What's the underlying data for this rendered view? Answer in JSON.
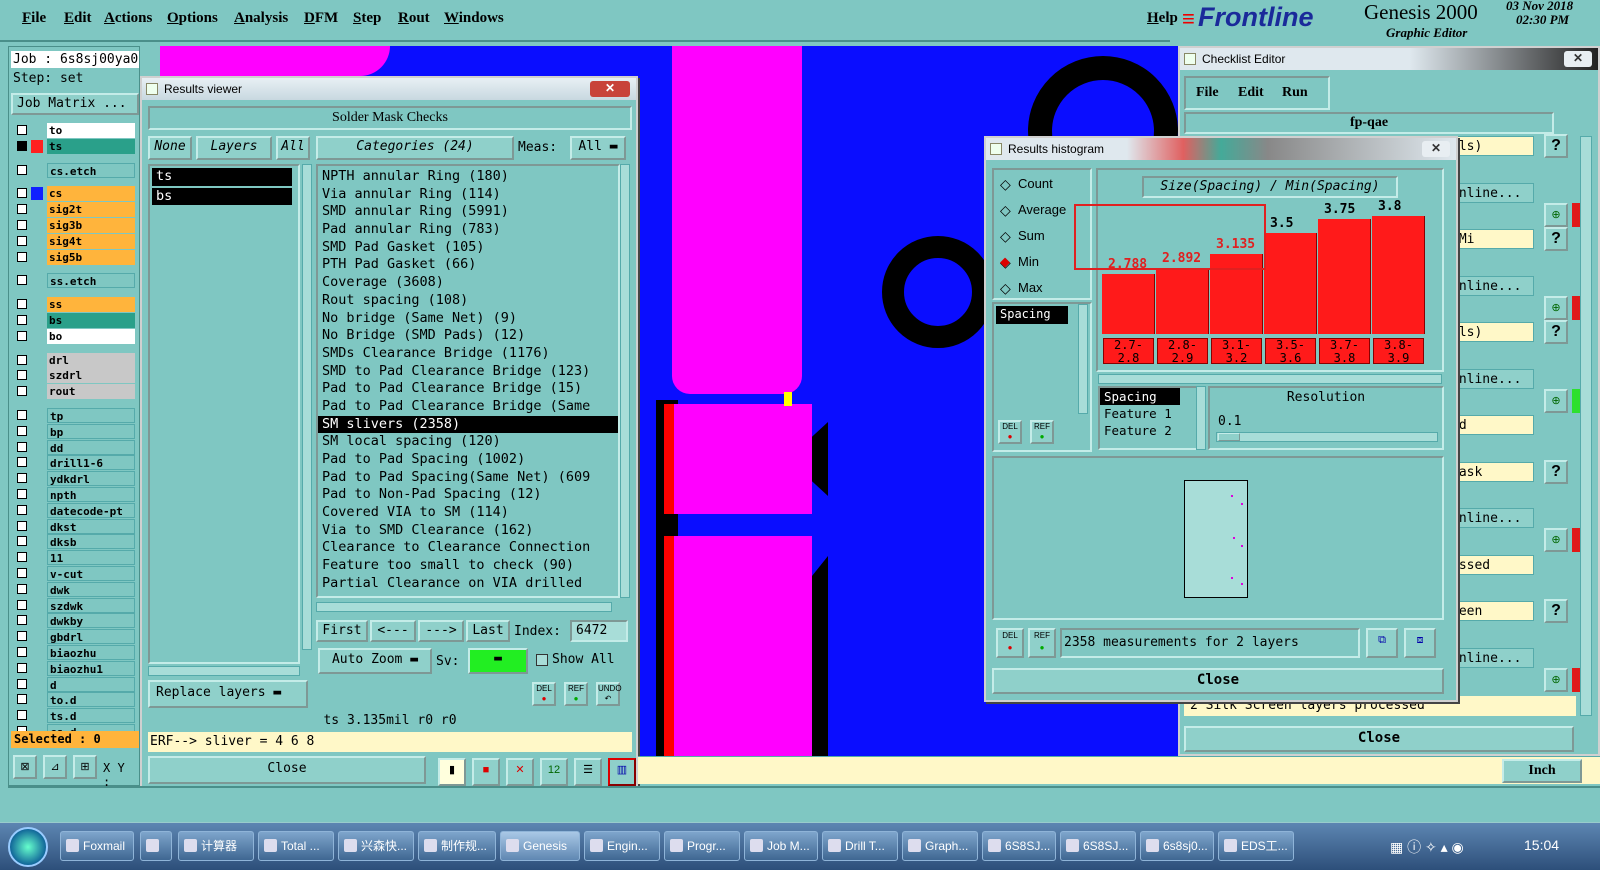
{
  "menubar": {
    "items": [
      "File",
      "Edit",
      "Actions",
      "Options",
      "Analysis",
      "DFM",
      "Step",
      "Rout",
      "Windows"
    ],
    "help": "Help"
  },
  "brand": {
    "logo": "Frontline",
    "product": "Genesis 2000",
    "subtitle": "Graphic Editor",
    "date": "03 Nov 2018",
    "time": "02:30 PM"
  },
  "job": {
    "job": "Job : 6s8sj00ya0",
    "step": "Step: set",
    "job_matrix": "Job Matrix ..."
  },
  "layers": [
    {
      "name": "to",
      "color": "#ffffff"
    },
    {
      "name": "ts",
      "color": "#2aa08a"
    },
    {
      "name": "cs.etch",
      "color": "#7fc7c2"
    },
    {
      "name": "cs",
      "color": "#ffb43c"
    },
    {
      "name": "sig2t",
      "color": "#ffb43c"
    },
    {
      "name": "sig3b",
      "color": "#ffb43c"
    },
    {
      "name": "sig4t",
      "color": "#ffb43c"
    },
    {
      "name": "sig5b",
      "color": "#ffb43c"
    },
    {
      "name": "ss.etch",
      "color": "#7fc7c2"
    },
    {
      "name": "ss",
      "color": "#ffb43c"
    },
    {
      "name": "bs",
      "color": "#2aa08a"
    },
    {
      "name": "bo",
      "color": "#ffffff"
    },
    {
      "name": "drl",
      "color": "#c8c8c8"
    },
    {
      "name": "szdrl",
      "color": "#c8c8c8"
    },
    {
      "name": "rout",
      "color": "#c8c8c8"
    },
    {
      "name": "tp",
      "color": "#7fc7c2"
    },
    {
      "name": "bp",
      "color": "#7fc7c2"
    },
    {
      "name": "dd",
      "color": "#7fc7c2"
    },
    {
      "name": "drill1-6",
      "color": "#7fc7c2"
    },
    {
      "name": "ydkdrl",
      "color": "#7fc7c2"
    },
    {
      "name": "npth",
      "color": "#7fc7c2"
    },
    {
      "name": "datecode-pt",
      "color": "#7fc7c2"
    },
    {
      "name": "dkst",
      "color": "#7fc7c2"
    },
    {
      "name": "dksb",
      "color": "#7fc7c2"
    },
    {
      "name": "11",
      "color": "#7fc7c2"
    },
    {
      "name": "v-cut",
      "color": "#7fc7c2"
    },
    {
      "name": "dwk",
      "color": "#7fc7c2"
    },
    {
      "name": "szdwk",
      "color": "#7fc7c2"
    },
    {
      "name": "dwkby",
      "color": "#7fc7c2"
    },
    {
      "name": "gbdrl",
      "color": "#7fc7c2"
    },
    {
      "name": "biaozhu",
      "color": "#7fc7c2"
    },
    {
      "name": "biaozhu1",
      "color": "#7fc7c2"
    },
    {
      "name": "d",
      "color": "#7fc7c2"
    },
    {
      "name": "to.d",
      "color": "#7fc7c2"
    },
    {
      "name": "ts.d",
      "color": "#7fc7c2"
    },
    {
      "name": "cs.d",
      "color": "#7fc7c2"
    }
  ],
  "selected": "Selected : 0",
  "xy": "X Y :",
  "results_viewer": {
    "title": "Results viewer",
    "header": "Solder Mask Checks",
    "none": "None",
    "layers": "Layers",
    "all": "All",
    "categories": "Categories (24)",
    "meas": "Meas:",
    "meas_val": "All",
    "layer_list": [
      "ts",
      "bs"
    ],
    "categories_list": [
      "NPTH annular Ring (180)",
      "Via annular Ring (114)",
      "SMD annular Ring (5991)",
      "Pad annular Ring (783)",
      "SMD Pad Gasket (105)",
      "PTH Pad Gasket (66)",
      "Coverage (3608)",
      "Rout spacing (108)",
      "No bridge (Same Net) (9)",
      "No Bridge (SMD Pads) (12)",
      "SMDs Clearance Bridge (1176)",
      "SMD to Pad Clearance Bridge (123)",
      "Pad to Pad Clearance Bridge (15)",
      "Pad to Pad Clearance Bridge (Same",
      "SM slivers (2358)",
      "SM local spacing (120)",
      "Pad to Pad Spacing (1002)",
      "Pad to Pad Spacing(Same Net) (609",
      "Pad to Non-Pad Spacing (12)",
      "Covered VIA to SM (114)",
      "Via to SMD Clearance (162)",
      "Clearance to Clearance Connection",
      "Feature too small to check (90)",
      "Partial Clearance on VIA drilled"
    ],
    "first": "First",
    "prev": "<---",
    "next": "--->",
    "last": "Last",
    "index_label": "Index:",
    "index_val": "6472",
    "auto_zoom": "Auto Zoom",
    "sv": "Sv:",
    "show_all": "Show All",
    "replace_layers": "Replace layers",
    "del": "DEL",
    "ref": "REF",
    "undo": "UNDO",
    "status": "ts 3.135mil  r0  r0",
    "erf": "ERF--> sliver = 4 6 8",
    "close": "Close"
  },
  "histogram": {
    "title": "Results histogram",
    "options": [
      "Count",
      "Average",
      "Sum",
      "Min",
      "Max"
    ],
    "selected_option": "Min",
    "list_item": "Spacing",
    "heading": "Size(Spacing) / Min(Spacing)",
    "bars": [
      {
        "value": "2.788",
        "v": 2.788,
        "range": "2.7-2.8"
      },
      {
        "value": "2.892",
        "v": 2.892,
        "range": "2.8-2.9"
      },
      {
        "value": "3.135",
        "v": 3.135,
        "range": "3.1-3.2"
      },
      {
        "value": "3.5",
        "v": 3.5,
        "range": "3.5-3.6"
      },
      {
        "value": "3.75",
        "v": 3.75,
        "range": "3.7-3.8"
      },
      {
        "value": "3.8",
        "v": 3.8,
        "range": "3.8-3.9"
      }
    ],
    "meas_list": [
      "Spacing",
      "Feature 1",
      "Feature 2"
    ],
    "resolution": "Resolution",
    "resolution_val": "0.1",
    "summary": "2358 measurements for 2 layers",
    "close": "Close",
    "del": "DEL",
    "ref": "REF"
  },
  "checklist": {
    "title": "Checklist Editor",
    "menu": [
      "File",
      "Edit",
      "Run"
    ],
    "name": "fp-qae",
    "rows": [
      "ils)",
      "Online...",
      "(Mi",
      "Online...",
      "ils)",
      "Online...",
      "ed",
      "mask",
      "Online...",
      "essed",
      "reen",
      "Online..."
    ],
    "footer": "2 Silk Screen layers processed",
    "close": "Close",
    "q": "?"
  },
  "inch": "Inch",
  "taskbar": {
    "items": [
      "Foxmail",
      "",
      "计算器",
      "Total ...",
      "兴森快...",
      "制作规...",
      "Genesis",
      "Engin...",
      "Progr...",
      "Job M...",
      "Drill T...",
      "Graph...",
      "6S8SJ...",
      "6S8SJ...",
      "6s8sj0...",
      "EDS工..."
    ],
    "clock": "15:04"
  }
}
